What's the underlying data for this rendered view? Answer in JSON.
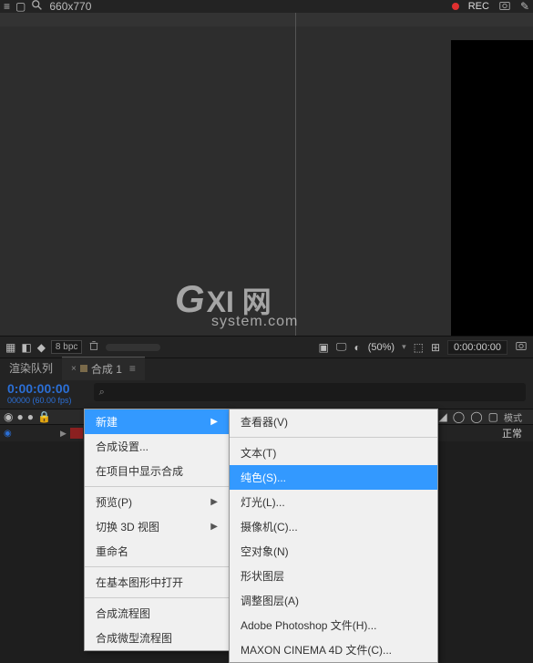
{
  "topbar": {
    "resolution": "660x770",
    "rec_label": "REC"
  },
  "watermark": {
    "g": "G",
    "cn": "XI 网",
    "domain": "system.com"
  },
  "panelbar": {
    "bpc": "8 bpc",
    "zoom": "(50%)",
    "timecode": "0:00:00:00"
  },
  "tabs": {
    "render_queue": "渲染队列",
    "comp_name": "合成 1"
  },
  "timeline": {
    "timecode": "0:00:00:00",
    "timecode_sub": "00000 (60.00 fps)",
    "search_placeholder": ""
  },
  "columns": {
    "mode_label": "模式",
    "normal": "正常"
  },
  "context_menu": {
    "items": [
      {
        "label": "新建",
        "arrow": true,
        "highlight": true
      },
      {
        "label": "合成设置...",
        "arrow": false
      },
      {
        "label": "在项目中显示合成",
        "arrow": false
      },
      {
        "sep": true
      },
      {
        "label": "预览(P)",
        "arrow": true
      },
      {
        "label": "切换 3D 视图",
        "arrow": true
      },
      {
        "label": "重命名",
        "arrow": false
      },
      {
        "sep": true
      },
      {
        "label": "在基本图形中打开",
        "arrow": false
      },
      {
        "sep": true
      },
      {
        "label": "合成流程图",
        "arrow": false
      },
      {
        "label": "合成微型流程图",
        "arrow": false
      }
    ]
  },
  "submenu": {
    "items": [
      {
        "label": "查看器(V)"
      },
      {
        "sep": true
      },
      {
        "label": "文本(T)"
      },
      {
        "label": "纯色(S)...",
        "highlight": true
      },
      {
        "label": "灯光(L)..."
      },
      {
        "label": "摄像机(C)..."
      },
      {
        "label": "空对象(N)"
      },
      {
        "label": "形状图层"
      },
      {
        "label": "调整图层(A)"
      },
      {
        "label": "Adobe Photoshop 文件(H)..."
      },
      {
        "label": "MAXON CINEMA 4D 文件(C)..."
      }
    ]
  }
}
